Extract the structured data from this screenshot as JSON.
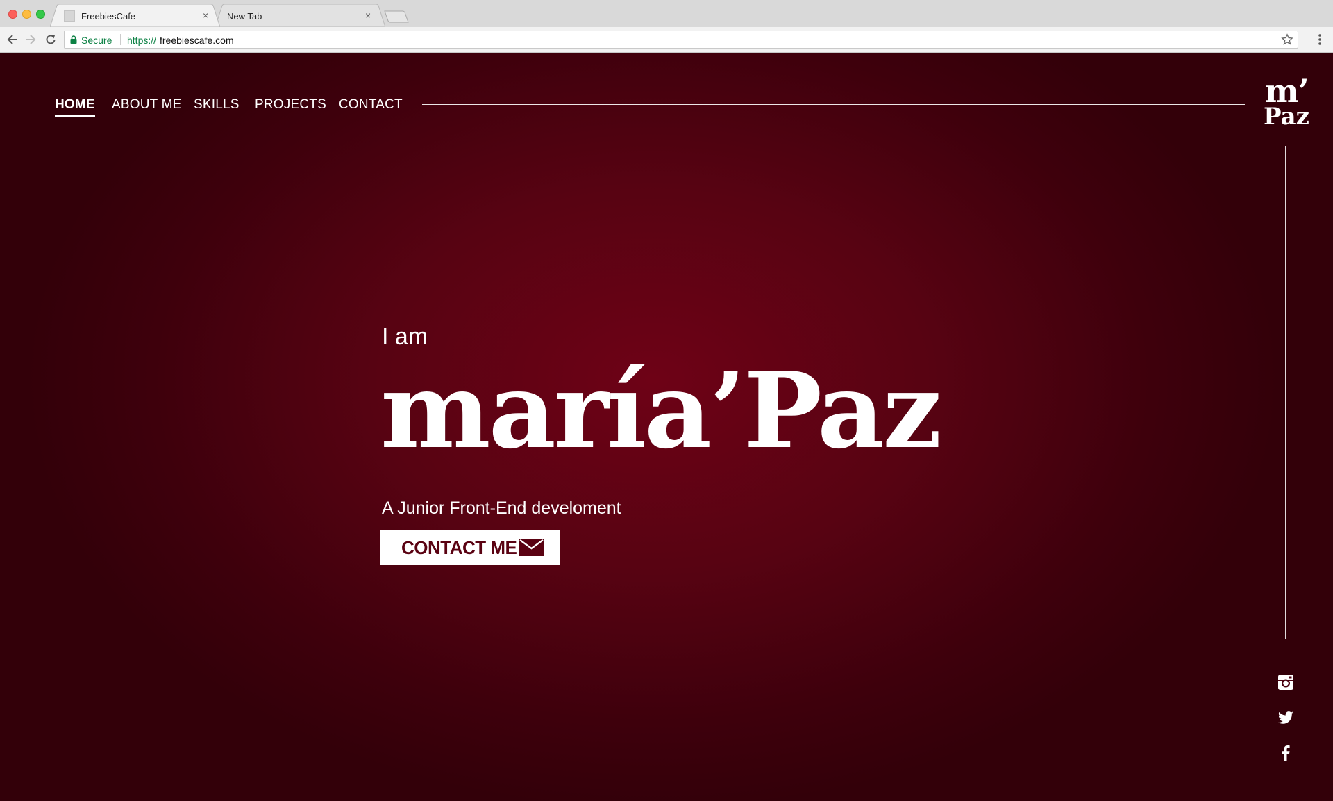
{
  "browser": {
    "tabs": [
      {
        "title": "FreebiesCafe",
        "close": "×"
      },
      {
        "title": "New Tab",
        "close": "×"
      }
    ],
    "omnibox": {
      "secure_label": "Secure",
      "url_scheme": "https://",
      "url_host": "freebiescafe.com"
    }
  },
  "nav": {
    "items": [
      {
        "label": "HOME",
        "active": true
      },
      {
        "label": "ABOUT ME"
      },
      {
        "label": "SKILLS"
      },
      {
        "label": "PROJECTS"
      },
      {
        "label": "CONTACT"
      }
    ]
  },
  "logo": {
    "line1": "m’",
    "line2": "Paz"
  },
  "hero": {
    "intro": "I am",
    "name": "maría’Paz",
    "subtitle": "A Junior Front-End develoment",
    "cta_label": "CONTACT ME",
    "cta_icon": "envelope-icon"
  },
  "social": [
    "instagram-icon",
    "twitter-icon",
    "facebook-icon"
  ],
  "colors": {
    "background_dark": "#330009",
    "background_light": "#6e0216",
    "accent_text": "#5a0212",
    "foreground": "#ffffff",
    "secure_green": "#0b8043"
  }
}
